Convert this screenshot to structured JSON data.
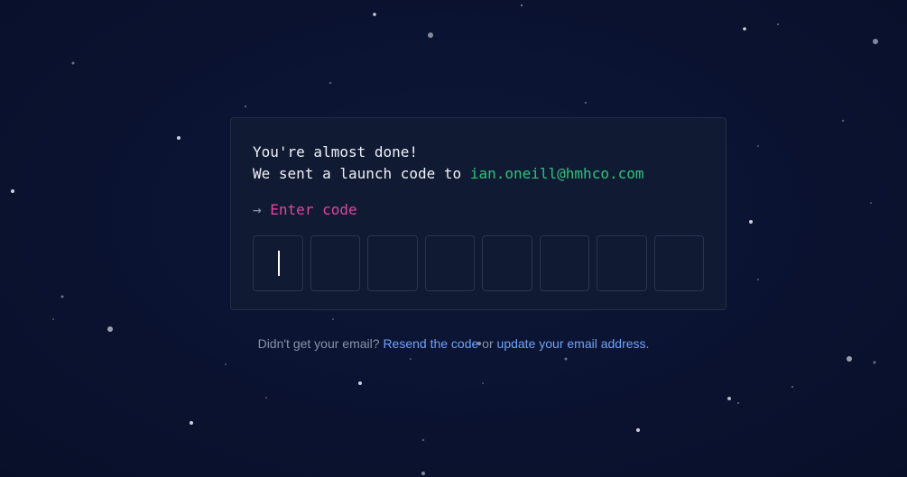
{
  "card": {
    "line1": "You're almost done!",
    "line2_prefix": "We sent a launch code to ",
    "email": "ian.oneill@hmhco.com",
    "arrow": "→",
    "prompt": "Enter code",
    "code_digits": [
      "",
      "",
      "",
      "",
      "",
      "",
      "",
      ""
    ]
  },
  "footer": {
    "question": "Didn't get your email? ",
    "resend_link": "Resend the code",
    "or_text": " or ",
    "update_link": "update your email address",
    "period": "."
  },
  "colors": {
    "background": "#0a1230",
    "card": "#111a33",
    "email": "#2ec27e",
    "prompt": "#e0449e",
    "link": "#6fa3f7"
  }
}
